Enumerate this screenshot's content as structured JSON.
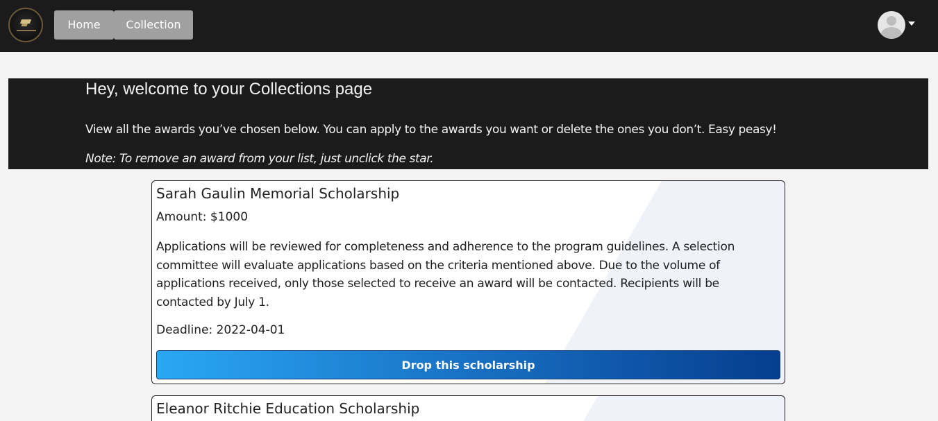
{
  "nav": {
    "home_label": "Home",
    "collection_label": "Collection"
  },
  "banner": {
    "title": "Hey, welcome to your Collections page",
    "subtitle": "View all the awards you’ve chosen below. You can apply to the awards you want or delete the ones you don’t. Easy peasy!",
    "note": "Note: To remove an award from your list, just unclick the star."
  },
  "cards": [
    {
      "title": "Sarah Gaulin Memorial Scholarship",
      "amount": "Amount: $1000",
      "description": "Applications will be reviewed for completeness and adherence to the program guidelines. A selection committee will evaluate applications based on the criteria mentioned above. Due to the volume of applications received, only those selected to receive an award will be contacted. Recipients will be contacted by July 1.",
      "deadline": "Deadline: 2022-04-01",
      "button_label": "Drop this scholarship"
    },
    {
      "title": "Eleanor Ritchie Education Scholarship"
    }
  ],
  "colors": {
    "navbar": "#1b1b1b",
    "button_gradient_start": "#2aa8f2",
    "button_gradient_end": "#063d8f"
  }
}
